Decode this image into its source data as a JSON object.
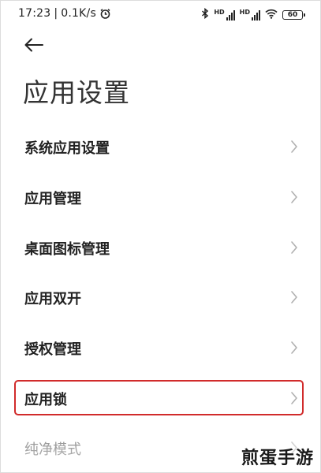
{
  "status_bar": {
    "time": "17:23",
    "network_speed": "0.1K/s",
    "separator": "|",
    "hd_label_1": "HD",
    "hd_label_2": "HD",
    "battery_level": "60",
    "icons": [
      "alarm-icon",
      "bluetooth-icon",
      "signal-icon",
      "signal-icon",
      "wifi-icon",
      "battery-icon"
    ]
  },
  "header": {
    "title": "应用设置"
  },
  "menu": {
    "items": [
      {
        "label": "系统应用设置"
      },
      {
        "label": "应用管理"
      },
      {
        "label": "桌面图标管理"
      },
      {
        "label": "应用双开"
      },
      {
        "label": "授权管理"
      },
      {
        "label": "应用锁"
      },
      {
        "label": "纯净模式"
      }
    ]
  },
  "watermark": {
    "text": "煎蛋手游"
  },
  "colors": {
    "highlight_border": "#d12b2b",
    "text_primary": "#222222",
    "chevron": "#b0b0b0"
  }
}
